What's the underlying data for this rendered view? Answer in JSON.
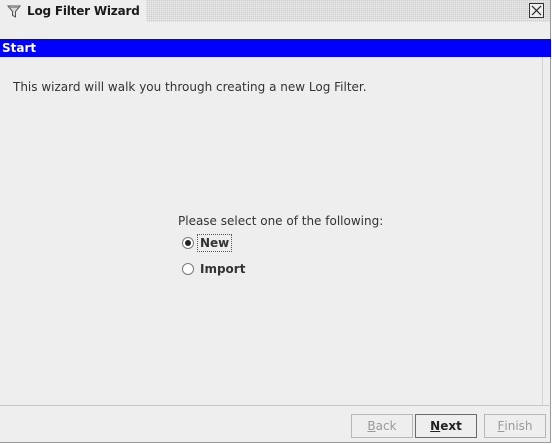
{
  "window": {
    "title": "Log Filter Wizard"
  },
  "step": {
    "name": "Start"
  },
  "content": {
    "intro": "This wizard will walk you through creating a new Log Filter.",
    "select_prompt": "Please select one of the following:",
    "options": [
      {
        "label": "New",
        "selected": true
      },
      {
        "label": "Import",
        "selected": false
      }
    ]
  },
  "buttons": {
    "back": {
      "first": "B",
      "rest": "ack",
      "enabled": false
    },
    "next": {
      "first": "N",
      "rest": "ext",
      "enabled": true
    },
    "finish": {
      "first": "F",
      "rest": "inish",
      "enabled": false
    }
  },
  "icons": {
    "title": "funnel-icon",
    "close": "close-icon"
  }
}
